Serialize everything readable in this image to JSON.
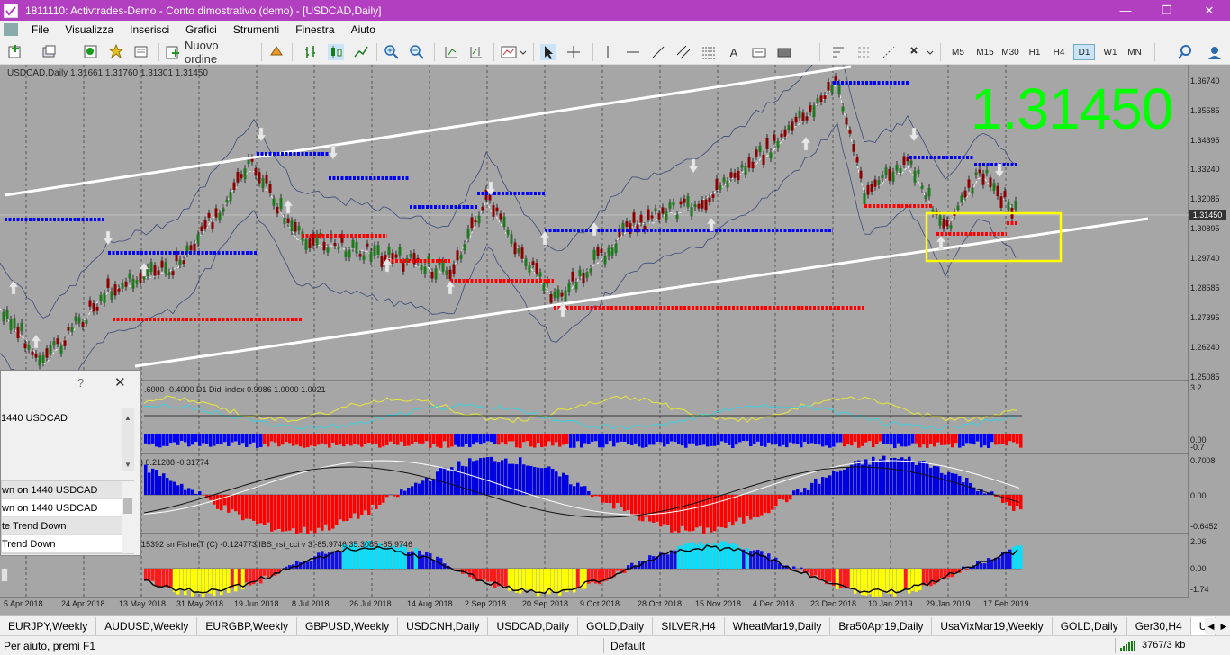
{
  "titlebar": {
    "title": "1811110: Activtrades-Demo - Conto dimostrativo (demo) - [USDCAD,Daily]",
    "minimize": "—",
    "restore": "❐",
    "close": "✕"
  },
  "menu": [
    "File",
    "Visualizza",
    "Inserisci",
    "Grafici",
    "Strumenti",
    "Finestra",
    "Aiuto"
  ],
  "toolbar": {
    "new_order": "Nuovo ordine",
    "timeframes": [
      "M5",
      "M15",
      "M30",
      "H1",
      "H4",
      "D1",
      "W1",
      "MN"
    ],
    "active_timeframe": "D1"
  },
  "chart": {
    "symbol_info": "USDCAD,Daily  1.31661 1.31760 1.31301 1.31450",
    "big_price": "1.31450",
    "current_price": "1.31450",
    "price_axis": [
      "1.36740",
      "1.35585",
      "1.34395",
      "1.33240",
      "1.32085",
      "1.30895",
      "1.29740",
      "1.28585",
      "1.27395",
      "1.26240",
      "1.25085"
    ],
    "date_axis": [
      "5 Apr 2018",
      "24 Apr 2018",
      "13 May 2018",
      "31 May 2018",
      "19 Jun 2018",
      "8 Jul 2018",
      "26 Jul 2018",
      "14 Aug 2018",
      "2 Sep 2018",
      "20 Sep 2018",
      "9 Oct 2018",
      "28 Oct 2018",
      "15 Nov 2018",
      "4 Dec 2018",
      "23 Dec 2018",
      "10 Jan 2019",
      "29 Jan 2019",
      "17 Feb 2019"
    ],
    "colors": {
      "background": "#a6a6a6",
      "up_candle": "#1f7a1f",
      "down_candle": "#8b0000",
      "support_red": "#ff0000",
      "resistance_blue": "#0000ff",
      "trend_line": "#ffffff",
      "highlight_box": "#ffff00",
      "big_price": "#00ff00"
    }
  },
  "indicators": {
    "ind1": {
      "label": ".6000 -0.4000  D1 Didi index 0.9986 1.0000 1.0021",
      "axis": [
        "3.2",
        "0.00",
        "-0.7"
      ]
    },
    "ind2": {
      "label": ") 0.21288 -0.31774",
      "axis": [
        "0.7008",
        "0.00",
        "-0.6452"
      ]
    },
    "ind3": {
      "label": "15392  smFisherT                   (C)  -0.124773  IBS_rsi_cci v 3 -85.9746 35.3085 -85.9746",
      "axis": [
        "2.06",
        "0.00",
        "-1.74"
      ]
    }
  },
  "dialog": {
    "help": "?",
    "close": "✕",
    "symbol": "1440 USDCAD",
    "alerts": [
      "wn on 1440 USDCAD",
      "wn on 1440 USDCAD",
      "te Trend Down",
      " Trend Down"
    ]
  },
  "tabs": [
    "EURJPY,Weekly",
    "AUDUSD,Weekly",
    "EURGBP,Weekly",
    "GBPUSD,Weekly",
    "USDCNH,Daily",
    "USDCAD,Daily",
    "GOLD,Daily",
    "SILVER,H4",
    "WheatMar19,Daily",
    "Bra50Apr19,Daily",
    "UsaVixMar19,Weekly",
    "GOLD,Daily",
    "Ger30,H4",
    "U"
  ],
  "active_tab": "U",
  "status": {
    "help": "Per aiuto, premi F1",
    "profile": "Default",
    "traffic": "3767/3 kb"
  }
}
